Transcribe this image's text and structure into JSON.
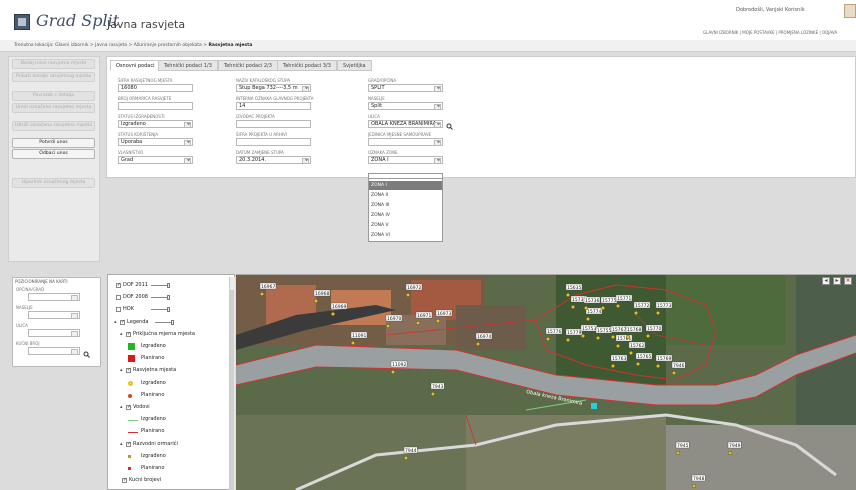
{
  "header": {
    "logo_text": "Grad Split",
    "app_title": "Javna rasvjeta",
    "welcome": "Dobrodošli, Vanjski Korisnik",
    "top_links": "GLAVNI IZBORNIK | MOJE POSTAVKE | PROMJENA LOZINKE | ODJAVA"
  },
  "breadcrumb": {
    "prefix": "Trenutna lokacija:",
    "path": "Glavni izbornik > Javna rasvjeta > Ažuriranje prostornih objekata >",
    "current": "Rasvjetna mjesta"
  },
  "sidebar": {
    "buttons": [
      {
        "label": "Dodaj novo rasvjetno mjesto",
        "active": false
      },
      {
        "label": "Prikaži detalje rasvjetnog mjesta",
        "active": false
      },
      {
        "label": "Povratak s detalja",
        "active": false
      },
      {
        "label": "Uredi označeno rasvjetno mjesto",
        "active": false
      },
      {
        "label": "Izbriši označeno rasvjetno mjesto",
        "active": false
      },
      {
        "label": "Potvrdi unos",
        "active": true
      },
      {
        "label": "Odbaci unos",
        "active": true
      },
      {
        "label": "Hiperlink označenog mjesta",
        "active": false
      }
    ]
  },
  "tabs": [
    "Osnovni podaci",
    "Tehnički podaci 1/3",
    "Tehnički podaci 2/3",
    "Tehnički podaci 3/3",
    "Svjetiljka"
  ],
  "form": {
    "col1": [
      {
        "label": "Šifra rasvjetnog mjesta",
        "value": "16080",
        "select": false
      },
      {
        "label": "Broj ormarića rasvjete",
        "value": "",
        "select": false
      },
      {
        "label": "Status izgrađenosti",
        "value": "Izgrađeno",
        "select": true
      },
      {
        "label": "Status korištenja",
        "value": "Uporaba",
        "select": true
      },
      {
        "label": "Vlasništvo",
        "value": "Grad",
        "select": true
      }
    ],
    "col2": [
      {
        "label": "Naziv kataloškog stupa",
        "value": "Stup Bega 732----3,5 m",
        "select": true
      },
      {
        "label": "Interna oznaka glavnog projekta",
        "value": "14",
        "select": false
      },
      {
        "label": "Izvođač projekta",
        "value": "",
        "select": false
      },
      {
        "label": "Šifra projekta u arhivi",
        "value": "",
        "select": false
      },
      {
        "label": "Datum zamjene stupa",
        "value": "20.3.2014.",
        "select": true
      }
    ],
    "col3": [
      {
        "label": "Grad/Općina",
        "value": "SPLIT",
        "select": true
      },
      {
        "label": "Naselje",
        "value": "Split",
        "select": true
      },
      {
        "label": "Ulica",
        "value": "OBALA KNEZA BRANIMIRA",
        "select": true
      },
      {
        "label": "Jedinica mjesne samouprave",
        "value": "",
        "select": true
      },
      {
        "label": "Oznaka zone",
        "value": "ZONA I",
        "select": true
      }
    ],
    "zone_options": [
      "ZONA I",
      "ZONA II",
      "ZONA III",
      "ZONA IV",
      "ZONA V",
      "ZONA VI"
    ]
  },
  "location_panel": {
    "title": "POZICIONIRANJE NA KARTI",
    "fields": [
      "OPĆINA/GRAD",
      "NASELJE",
      "ULICA",
      "KUĆNI BROJ"
    ]
  },
  "layers": [
    {
      "label": "DOF 2011",
      "type": "check",
      "checked": true,
      "indent": 0,
      "slider": true
    },
    {
      "label": "DOF 2008",
      "type": "check",
      "checked": false,
      "indent": 0,
      "slider": true
    },
    {
      "label": "HOK",
      "type": "check",
      "checked": false,
      "indent": 0,
      "slider": true
    },
    {
      "label": "Legenda",
      "type": "group",
      "checked": true,
      "indent": 0,
      "slider": true
    },
    {
      "label": "Priključna mjerna mjesta",
      "type": "group",
      "checked": true,
      "indent": 1,
      "slider": false
    },
    {
      "label": "Izgrađeno",
      "type": "legend",
      "symbol": "square",
      "color": "#21b521",
      "indent": 2
    },
    {
      "label": "Planirano",
      "type": "legend",
      "symbol": "square",
      "color": "#d81c1c",
      "indent": 2
    },
    {
      "label": "Rasvjetna mjesta",
      "type": "group",
      "checked": true,
      "indent": 1,
      "slider": false
    },
    {
      "label": "Izgrađeno",
      "type": "legend",
      "symbol": "ring",
      "color": "#e6c21a",
      "indent": 2
    },
    {
      "label": "Planirano",
      "type": "legend",
      "symbol": "dot",
      "color": "#d8402a",
      "indent": 2
    },
    {
      "label": "Vodovi",
      "type": "group",
      "checked": true,
      "indent": 1,
      "slider": false
    },
    {
      "label": "Izgrađeno",
      "type": "legend",
      "symbol": "line",
      "color": "#7cd27c",
      "indent": 2
    },
    {
      "label": "Planirano",
      "type": "legend",
      "symbol": "line",
      "color": "#d23030",
      "indent": 2
    },
    {
      "label": "Razvodni ormarići",
      "type": "group",
      "checked": true,
      "indent": 1,
      "slider": false
    },
    {
      "label": "Izgrađeno",
      "type": "legend",
      "symbol": "small",
      "color": "#b39e22",
      "indent": 2
    },
    {
      "label": "Planirano",
      "type": "legend",
      "symbol": "small",
      "color": "#d23030",
      "indent": 2
    },
    {
      "label": "Kućni brojevi",
      "type": "check",
      "checked": true,
      "indent": 1,
      "slider": false
    }
  ],
  "map": {
    "street_label": "Obala kneza Branimira",
    "labels": [
      "16967",
      "16968",
      "16969",
      "16972",
      "16971",
      "16970",
      "16973",
      "16974",
      "11091",
      "11092",
      "7943",
      "7944",
      "15635",
      "15735",
      "15736",
      "15775",
      "15771",
      "15772",
      "15773",
      "15774",
      "15776",
      "15779",
      "15753",
      "15755",
      "15767",
      "15768",
      "15770",
      "15761",
      "15762",
      "15763",
      "15765",
      "15769",
      "7946",
      "7945",
      "7948",
      "7949"
    ]
  },
  "colors": {
    "accent": "#3d4f66",
    "built_light": "#e6c21a",
    "planned_line": "#d23030"
  }
}
